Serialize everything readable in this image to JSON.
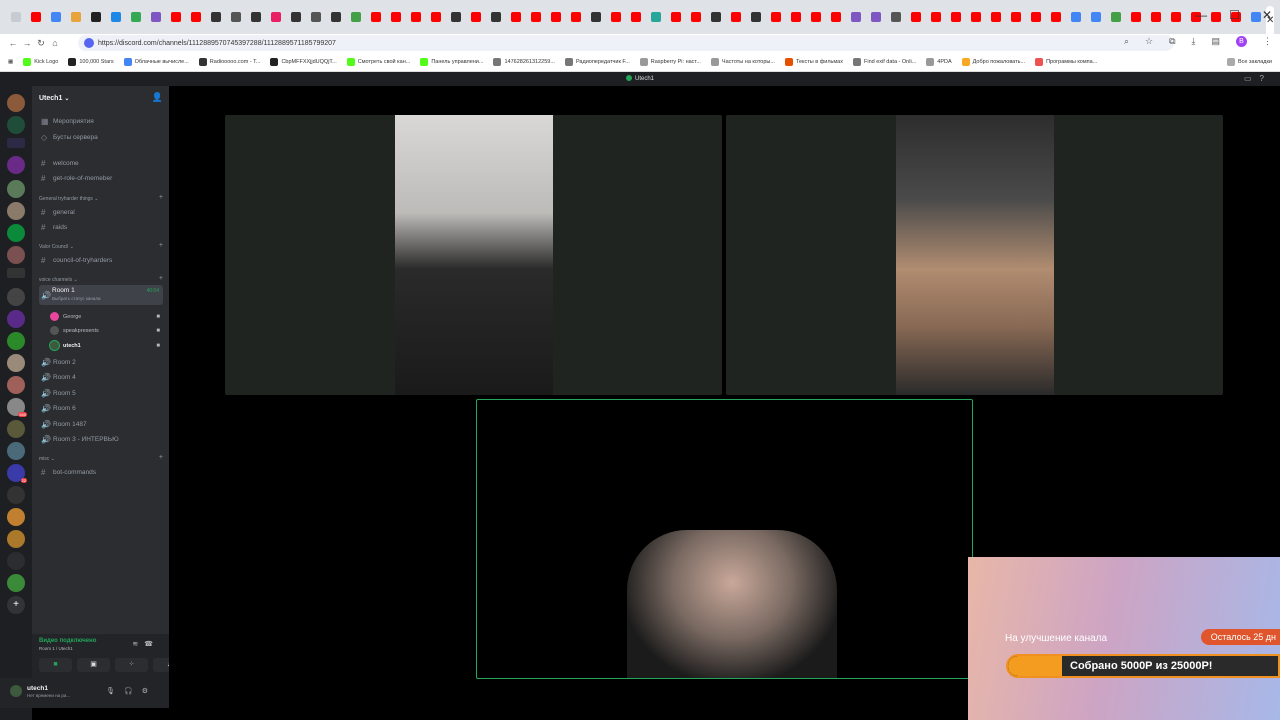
{
  "browser": {
    "url": "https://discord.com/channels/1112889570745397288/1112889571185799207",
    "bookmarks": [
      "Kick Logo",
      "100,000 Stars",
      "Облачные вычисле...",
      "Radiooooo.com - T...",
      "CbpMFFXXjjdUQQjT...",
      "Смотреть свой кан...",
      "Панель управлени...",
      "147628261312259...",
      "Радиопередатчик F...",
      "Raspberry Pi: наст...",
      "Частоты на которы...",
      "Тексты в фильмах",
      "Find exif data - Onli...",
      "4PDA",
      "Добро пожаловать...",
      "Программы компа..."
    ],
    "bookmarks_right": "Все закладки",
    "profile_initial": "B"
  },
  "window": {
    "title": "Utech1"
  },
  "server": {
    "name": "Utech1",
    "top_items": [
      "Мероприятия",
      "Бусты сервера"
    ],
    "channels_top": [
      "welcome",
      "get-role-of-memeber"
    ],
    "cat1": "General tryharder things",
    "cat1_channels": [
      "general",
      "raids"
    ],
    "cat2": "Valor Council",
    "cat2_channels": [
      "council-of-tryharders"
    ],
    "cat3": "voice channels",
    "active_room": {
      "name": "Room 1",
      "status": "Выбрать статус канала",
      "timer": "40:04"
    },
    "members": [
      "George",
      "speakpresents",
      "utech1"
    ],
    "rooms": [
      "Room 2",
      "Room 4",
      "Room 5",
      "Room 6",
      "Room 1487",
      "Room 3 - ИНТЕРВЬЮ"
    ],
    "cat4": "misc",
    "cat4_channels": [
      "bot-commands"
    ]
  },
  "voice": {
    "status": "Видео подключено",
    "channel": "Room 1 / Utech1"
  },
  "user": {
    "name": "utech1",
    "status": "Нет времени на ра..."
  },
  "overlay": {
    "title": "На улучшение канала",
    "remaining": "Осталось 25 дн",
    "collected": "Собрано 5000Р из 25000Р!",
    "progress": 0.2
  },
  "guild_badges": [
    "540",
    "22"
  ],
  "colors": {
    "accent": "#23a55a",
    "blurple": "#5865f2"
  }
}
